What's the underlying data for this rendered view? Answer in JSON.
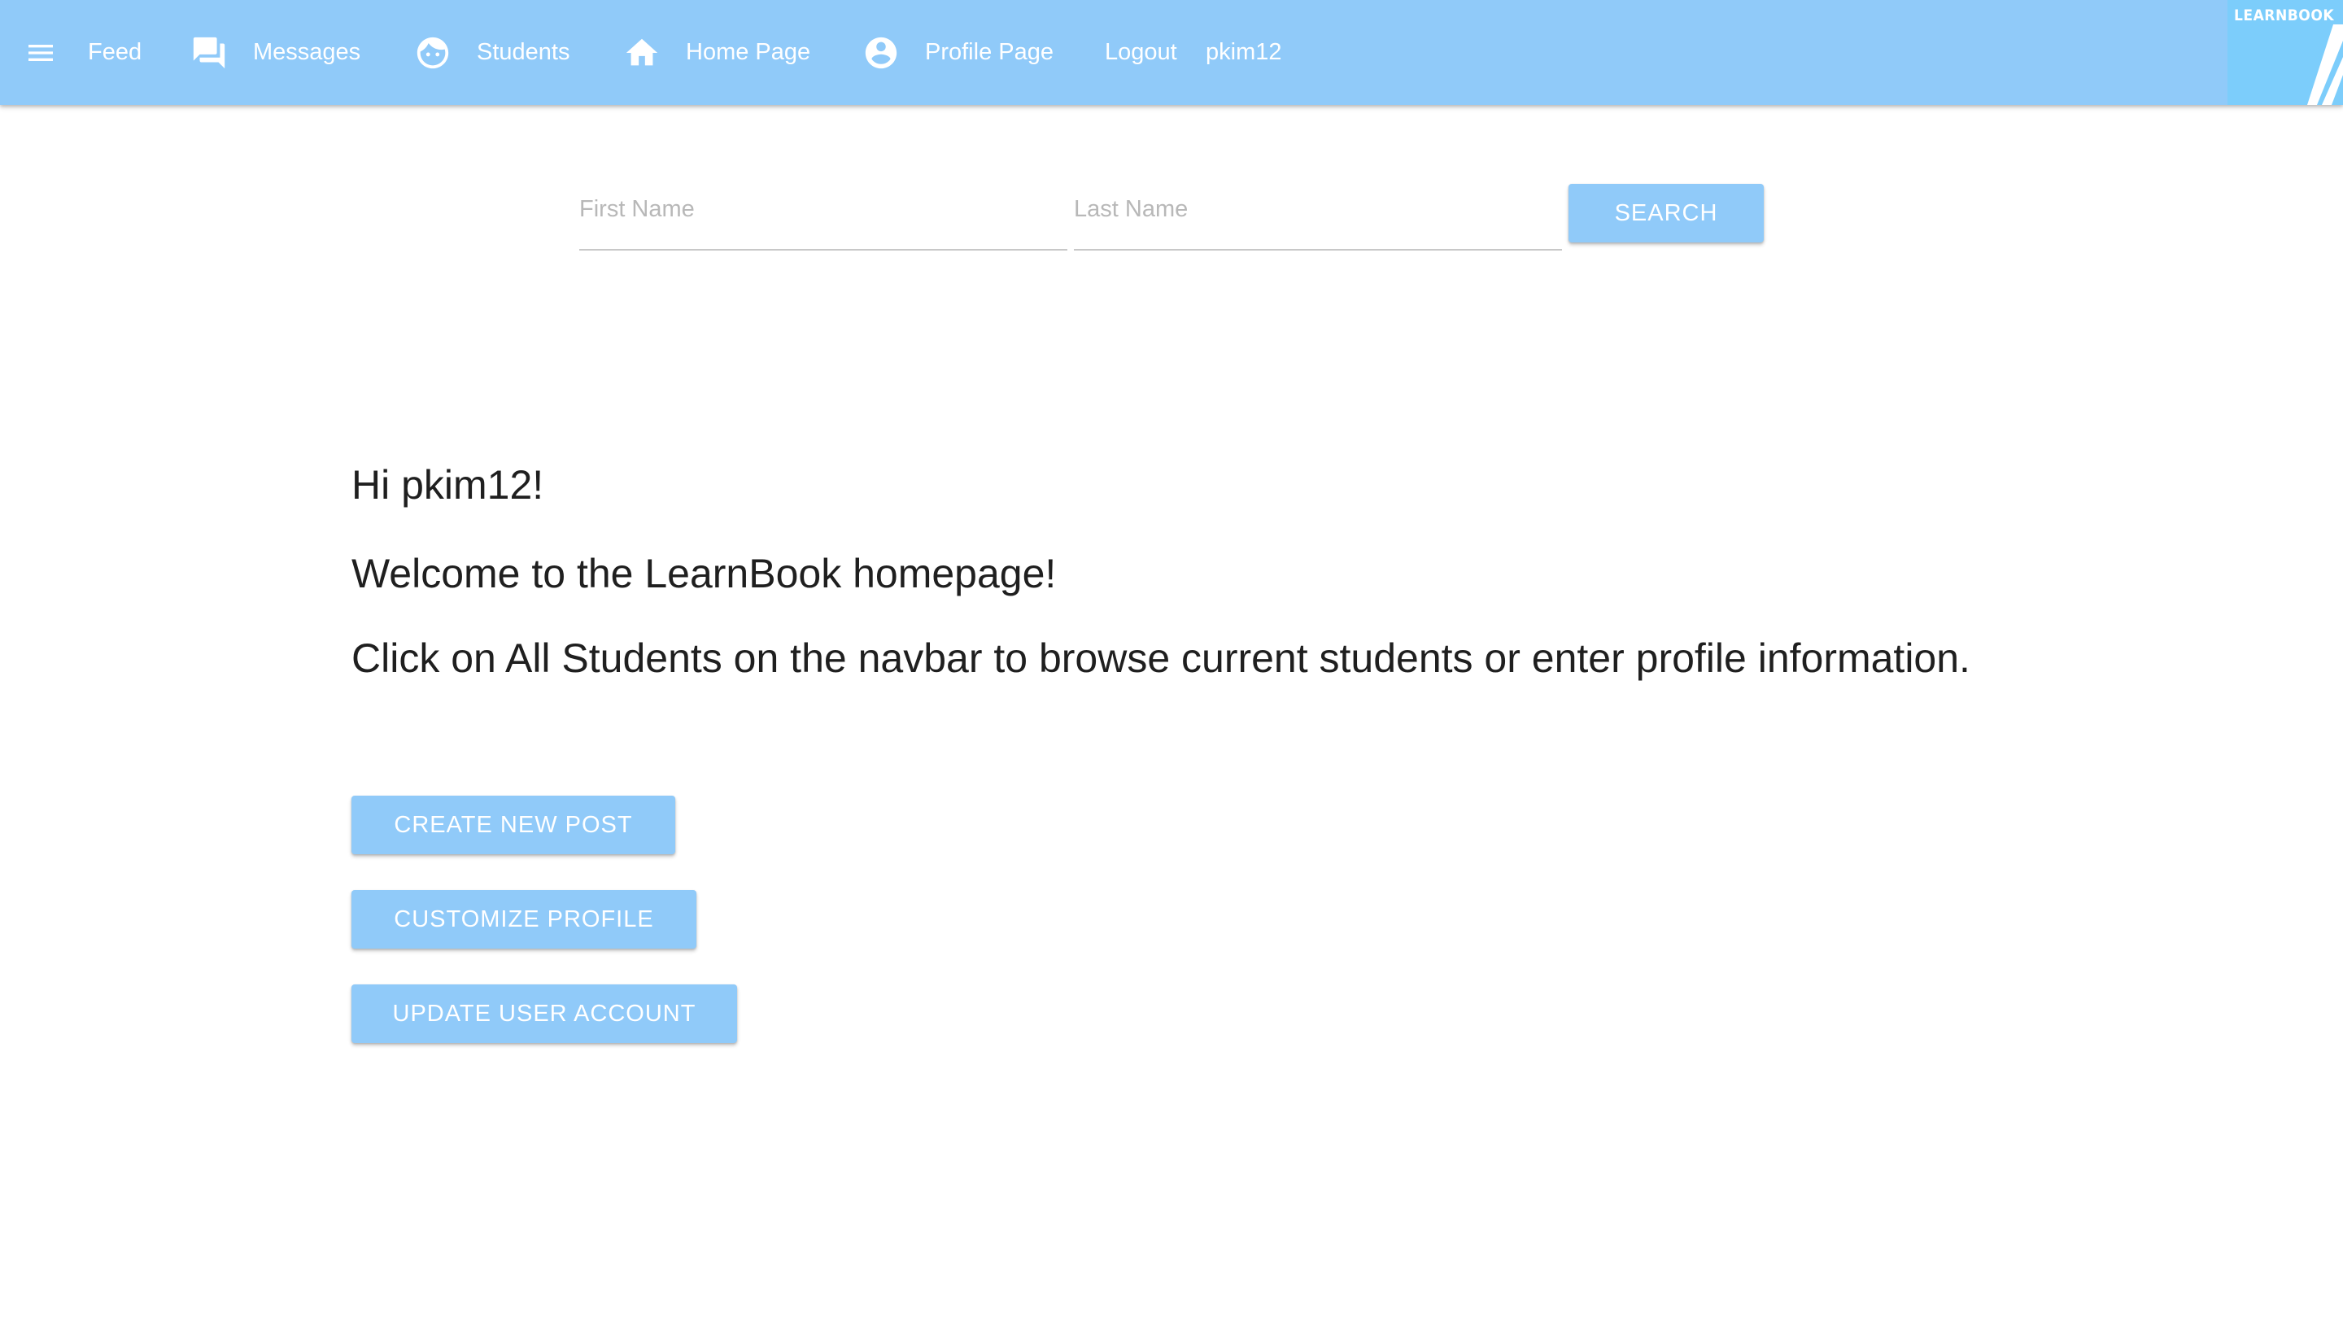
{
  "navbar": {
    "feed_label": "Feed",
    "messages_label": "Messages",
    "students_label": "Students",
    "home_label": "Home Page",
    "profile_label": "Profile Page",
    "logout_label": "Logout",
    "username": "pkim12",
    "icons": [
      "menu-icon",
      "chat-icon",
      "face-icon",
      "home-icon",
      "account-circle-icon"
    ]
  },
  "logo": {
    "text": "LEARNBOOK"
  },
  "search": {
    "first_name_placeholder": "First Name",
    "first_name_value": "",
    "last_name_placeholder": "Last Name",
    "last_name_value": "",
    "button_label": "SEARCH"
  },
  "main": {
    "greeting": "Hi pkim12!",
    "welcome": "Welcome to the LearnBook homepage!",
    "instructions": "Click on All Students on the navbar to browse current students or enter profile information."
  },
  "actions": {
    "create_post_label": "CREATE NEW POST",
    "customize_profile_label": "CUSTOMIZE PROFILE",
    "update_account_label": "UPDATE USER ACCOUNT"
  },
  "colors": {
    "navbar_bg": "#90caf9",
    "button_bg": "#90caf9",
    "logo_bg": "#7ccdfb",
    "text": "#1f1f1f"
  }
}
